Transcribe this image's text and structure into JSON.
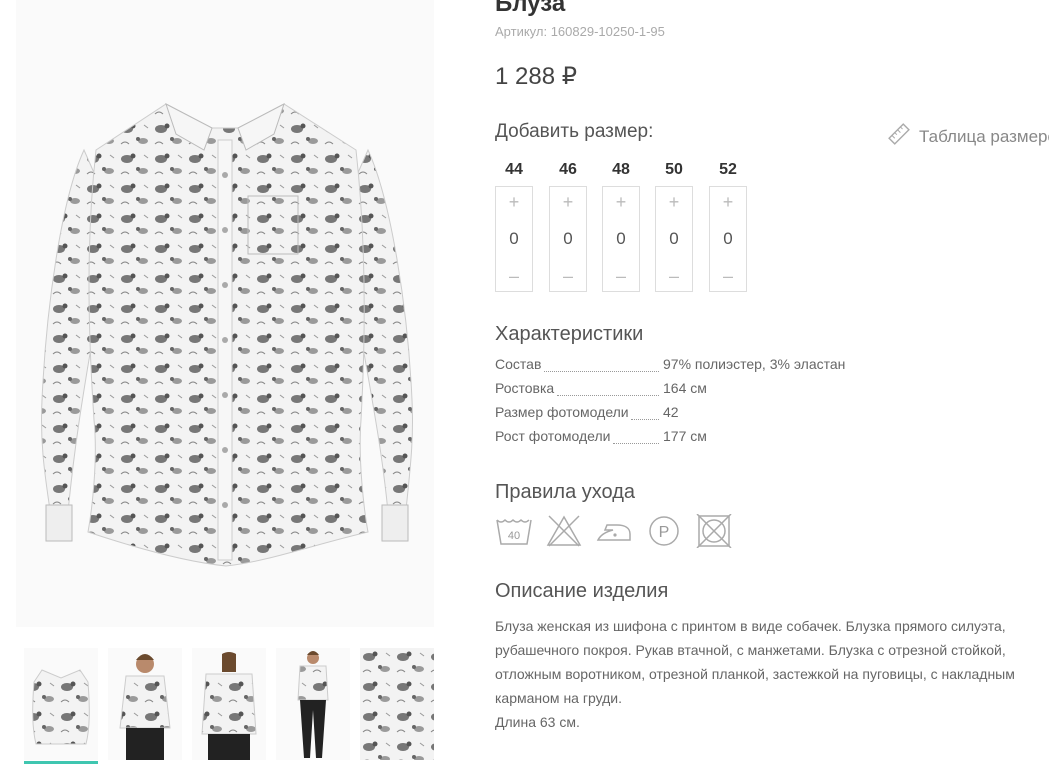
{
  "product": {
    "title": "Блуза",
    "sku": "Артикул: 160829-10250-1-95",
    "price": "1 288 ₽"
  },
  "sizes": {
    "heading": "Добавить размер:",
    "table_link": "Таблица размеров",
    "plus": "+",
    "minus": "–",
    "items": [
      {
        "size": "44",
        "qty": "0"
      },
      {
        "size": "46",
        "qty": "0"
      },
      {
        "size": "48",
        "qty": "0"
      },
      {
        "size": "50",
        "qty": "0"
      },
      {
        "size": "52",
        "qty": "0"
      }
    ]
  },
  "characteristics": {
    "heading": "Характеристики",
    "rows": [
      {
        "label": "Состав",
        "value": "97% полиэстер, 3% эластан"
      },
      {
        "label": "Ростовка",
        "value": "164 см"
      },
      {
        "label": "Размер фотомодели",
        "value": "42"
      },
      {
        "label": "Рост фотомодели",
        "value": "177 см"
      }
    ]
  },
  "care": {
    "heading": "Правила ухода",
    "wash_temp": "40",
    "dry_clean_letter": "P",
    "icons": [
      "wash-40-icon",
      "no-bleach-icon",
      "iron-low-icon",
      "dry-clean-p-icon",
      "no-tumble-dry-icon"
    ]
  },
  "description": {
    "heading": "Описание изделия",
    "text": "Блуза женская из шифона с принтом в виде собачек. Блузка прямого силуэта, рубашечного покроя. Рукав втачной, с манжетами. Блузка с отрезной стойкой, отложным воротником, отрезной планкой, застежкой на пуговицы, с накладным карманом на груди.",
    "length": "Длина 63 см."
  },
  "gallery": {
    "active_index": 0,
    "accent_color": "#3fc6b0",
    "thumb_count": 5
  }
}
